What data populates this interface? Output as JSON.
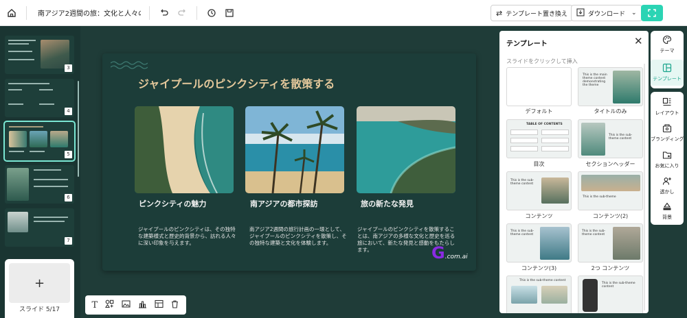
{
  "topbar": {
    "document_title": "南アジア2週間の旅：文化と人々の...",
    "template_replace_label": "テンプレート置き換え",
    "download_label": "ダウンロード"
  },
  "sidebar": {
    "thumbnails": [
      {
        "number": "3"
      },
      {
        "number": "4"
      },
      {
        "number": "5"
      },
      {
        "number": "6"
      },
      {
        "number": "7"
      }
    ],
    "slide_counter": "スライド 5/17"
  },
  "slide": {
    "title": "ジャイプールのピンクシティを散策する",
    "columns": [
      {
        "heading": "ピンクシティの魅力",
        "body": "ジャイプールのピンクシティは、その独特な建築様式と歴史的背景から、訪れる人々に深い印象を与えます。"
      },
      {
        "heading": "南アジアの都市探訪",
        "body": "南アジア2週間の旅行計画の一環として、ジャイプールのピンクシティを散策し、その独特な建築と文化を体験します。"
      },
      {
        "heading": "旅の新たな発見",
        "body": "ジャイプールのピンクシティを散策することは、南アジアの多様な文化と歴史を巡る旅において、新たな発見と感動をもたらします。"
      }
    ]
  },
  "watermark": {
    "g": "G",
    "text": ".com.ai"
  },
  "template_panel": {
    "title": "テンプレート",
    "hint": "スライドをクリックして挿入",
    "templates": [
      {
        "label": "デフォルト"
      },
      {
        "label": "タイトルのみ",
        "preview_text": "This is the main theme content demonstrating the theme"
      },
      {
        "label": "目次",
        "preview_text": "TABLE OF CONTENTS"
      },
      {
        "label": "セクションヘッダー",
        "preview_text": "This is the sub-theme content"
      },
      {
        "label": "コンテンツ",
        "preview_text": "This is the sub-theme content"
      },
      {
        "label": "コンテンツ(2)",
        "preview_text": "This is the sub-theme"
      },
      {
        "label": "コンテンツ(3)",
        "preview_text": "This is the sub-theme content"
      },
      {
        "label": "2つ コンテンツ",
        "preview_text": "This is the sub-theme content"
      },
      {
        "preview_text": "This is the sub-theme content"
      },
      {
        "preview_text": "This is the sub-theme content"
      }
    ]
  },
  "right_rail": {
    "items": [
      {
        "label": "テーマ",
        "icon": "palette-icon"
      },
      {
        "label": "テンプレート",
        "icon": "template-icon"
      },
      {
        "label": "レイアウト",
        "icon": "layout-icon"
      },
      {
        "label": "ブランディング",
        "icon": "branding-icon"
      },
      {
        "label": "お気に入り",
        "icon": "favorite-folder-icon"
      },
      {
        "label": "透かし",
        "icon": "watermark-icon"
      },
      {
        "label": "背景",
        "icon": "background-icon"
      }
    ]
  },
  "colors": {
    "workspace_bg": "#1f3c38",
    "slide_bg": "#1c3d39",
    "accent": "#2bd4b4",
    "slide_title": "#e4c89b"
  }
}
